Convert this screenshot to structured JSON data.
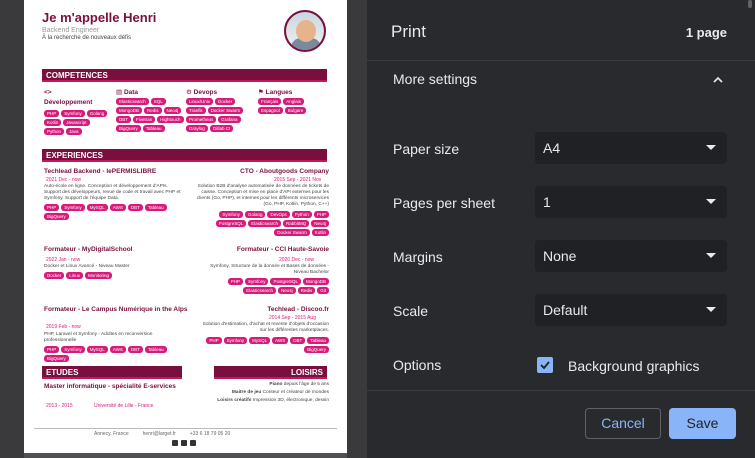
{
  "preview": {
    "name": "Je m'appelle Henri",
    "role": "Backend Engineer",
    "tagline": "À la recherche de nouveaux défis",
    "sections": {
      "competences": "COMPETENCES",
      "experiences": "EXPERIENCES",
      "etudes": "ETUDES",
      "loisirs": "LOISIRS"
    },
    "skills": {
      "dev": {
        "title": "Développement",
        "tags": [
          "PHP",
          "Symfony",
          "Golang",
          "Kotlin",
          "Javascript",
          "Python",
          "Java"
        ]
      },
      "data": {
        "title": "Data",
        "tags": [
          "Elasticsearch",
          "SQL",
          "MongoDB",
          "Redis",
          "Neo4j",
          "DBT",
          "Fivetran",
          "Hightouch",
          "BigQuery",
          "Tableau"
        ]
      },
      "devops": {
        "title": "Devops",
        "tags": [
          "Linux/Unix",
          "Docker",
          "Traefik",
          "Docker Swarm",
          "Prometheus",
          "Grafana",
          "Graylog",
          "Gitlab CI"
        ]
      },
      "langues": {
        "title": "Langues",
        "tags": [
          "Français",
          "Anglais",
          "Espagnol",
          "Bulgare"
        ]
      }
    },
    "jobs": [
      {
        "title": "Techlead Backend - lePERMISLIBRE",
        "date": "2021 Dec - now",
        "desc": "Auto-école en ligne. Conception et développement d'APIs. Support des développeurs, revue de code et travail avec PHP et Symfony. Support de l'équipe Data.",
        "tags": [
          "PHP",
          "Symfony",
          "MySQL",
          "AWS",
          "DBT",
          "Tableau",
          "BigQuery"
        ]
      },
      {
        "title": "CTO - Aboutgoods Company",
        "date": "2015 Sep - 2021 Nov",
        "desc": "Solution B2B d'analyse automatisée de données de tickets de caisse. Conception et mise en place d'API externes pour les clients (Go, PHP), et internes pour les différents microservices (Go, PHP, Kotlin, Python, C++)",
        "tags": [
          "Symfony",
          "Golang",
          "DevOps",
          "Python",
          "PHP",
          "PostgreSQL",
          "Elasticsearch",
          "RabbitMQ",
          "Neo4j",
          "Docker Swarm",
          "Kotlin"
        ]
      },
      {
        "title": "Formateur - MyDigitalSchool",
        "date": "2022 Jan - now",
        "desc": "Docker et Linux Avancé - Niveau Master",
        "tags": [
          "Docker",
          "Linux",
          "Monitoring"
        ]
      },
      {
        "title": "Formateur - CCI Haute-Savoie",
        "date": "2020 Dec - now",
        "desc": "Symfony, Structure de la donnée et Bases de données - Niveau Bachelor",
        "tags": [
          "PHP",
          "Symfony",
          "PostgreSQL",
          "MongoDB",
          "Elasticsearch",
          "Neo4j",
          "Redis",
          "Git"
        ]
      },
      {
        "title": "Formateur - Le Campus Numérique in the Alps",
        "date": "2019 Feb - now",
        "desc": "PHP, Laravel et Symfony - Adultes en reconversion professionnelle",
        "tags": [
          "PHP",
          "Symfony",
          "MySQL",
          "AWS",
          "DBT",
          "Tableau",
          "BigQuery"
        ]
      },
      {
        "title": "Techlead - Discoo.fr",
        "date": "2014 Sep - 2015 Aug",
        "desc": "Solution d'estimation, d'achat et revente d'objets d'occasion sur les différentes marketplaces.",
        "tags": [
          "PHP",
          "Symfony",
          "MySQL",
          "AWS",
          "DBT",
          "Tableau",
          "BigQuery"
        ]
      }
    ],
    "education": {
      "title": "Master informatique - spécialité E-services",
      "date": "2013 - 2015",
      "school": "Université de Lille - France"
    },
    "hobbies": [
      {
        "label": "Piano",
        "text": "depuis l'âge de 5 ans"
      },
      {
        "label": "Maitre de jeu",
        "text": "Conteur et créateur de mondes"
      },
      {
        "label": "Loisirs créatifs",
        "text": "Impression 3D, électronique, dessin"
      }
    ],
    "footer": {
      "location": "Annecy, France",
      "email": "henri@larget.fr",
      "phone": "+33 6 18 79 05 20"
    }
  },
  "panel": {
    "title": "Print",
    "pages": "1 page",
    "more_settings": "More settings",
    "paper_size": {
      "label": "Paper size",
      "value": "A4"
    },
    "pages_per_sheet": {
      "label": "Pages per sheet",
      "value": "1"
    },
    "margins": {
      "label": "Margins",
      "value": "None"
    },
    "scale": {
      "label": "Scale",
      "value": "Default"
    },
    "options": {
      "label": "Options",
      "checkbox_label": "Background graphics",
      "checked": true
    },
    "cancel": "Cancel",
    "save": "Save"
  },
  "colors": {
    "accent": "#8ab4f8",
    "brand": "#7a0f3d",
    "tag": "#d81b7a"
  }
}
